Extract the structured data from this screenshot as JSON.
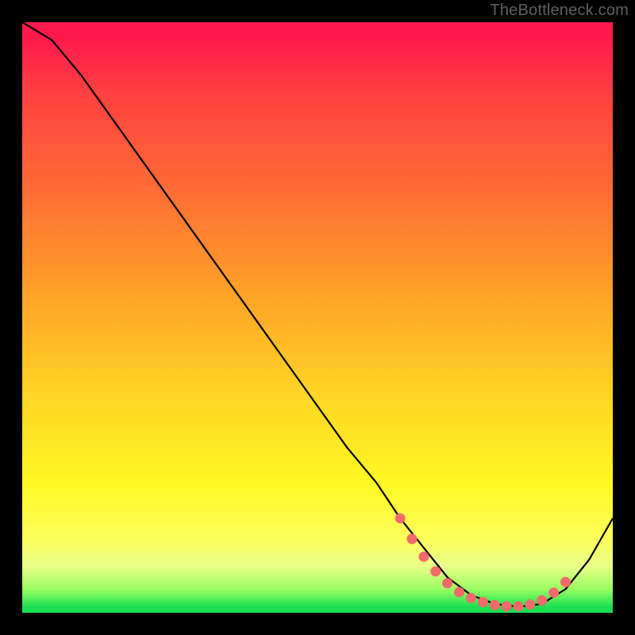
{
  "watermark": "TheBottleneck.com",
  "chart_data": {
    "type": "line",
    "title": "",
    "xlabel": "",
    "ylabel": "",
    "xlim": [
      0,
      100
    ],
    "ylim": [
      0,
      100
    ],
    "series": [
      {
        "name": "curve",
        "x": [
          0,
          5,
          10,
          15,
          20,
          25,
          30,
          35,
          40,
          45,
          50,
          55,
          60,
          64,
          68,
          72,
          76,
          80,
          84,
          88,
          92,
          96,
          100
        ],
        "y": [
          100,
          97,
          91,
          84,
          77,
          70,
          63,
          56,
          49,
          42,
          35,
          28,
          22,
          16,
          11,
          6,
          3,
          1.5,
          1,
          1.5,
          4,
          9,
          16
        ]
      }
    ],
    "markers": {
      "name": "highlight-dots",
      "color": "#f26a6a",
      "x": [
        64,
        66,
        68,
        70,
        72,
        74,
        76,
        78,
        80,
        82,
        84,
        86,
        88,
        90,
        92
      ],
      "y": [
        16,
        12.5,
        9.5,
        7,
        5,
        3.5,
        2.5,
        1.8,
        1.3,
        1.1,
        1.1,
        1.4,
        2.1,
        3.4,
        5.2
      ]
    }
  }
}
